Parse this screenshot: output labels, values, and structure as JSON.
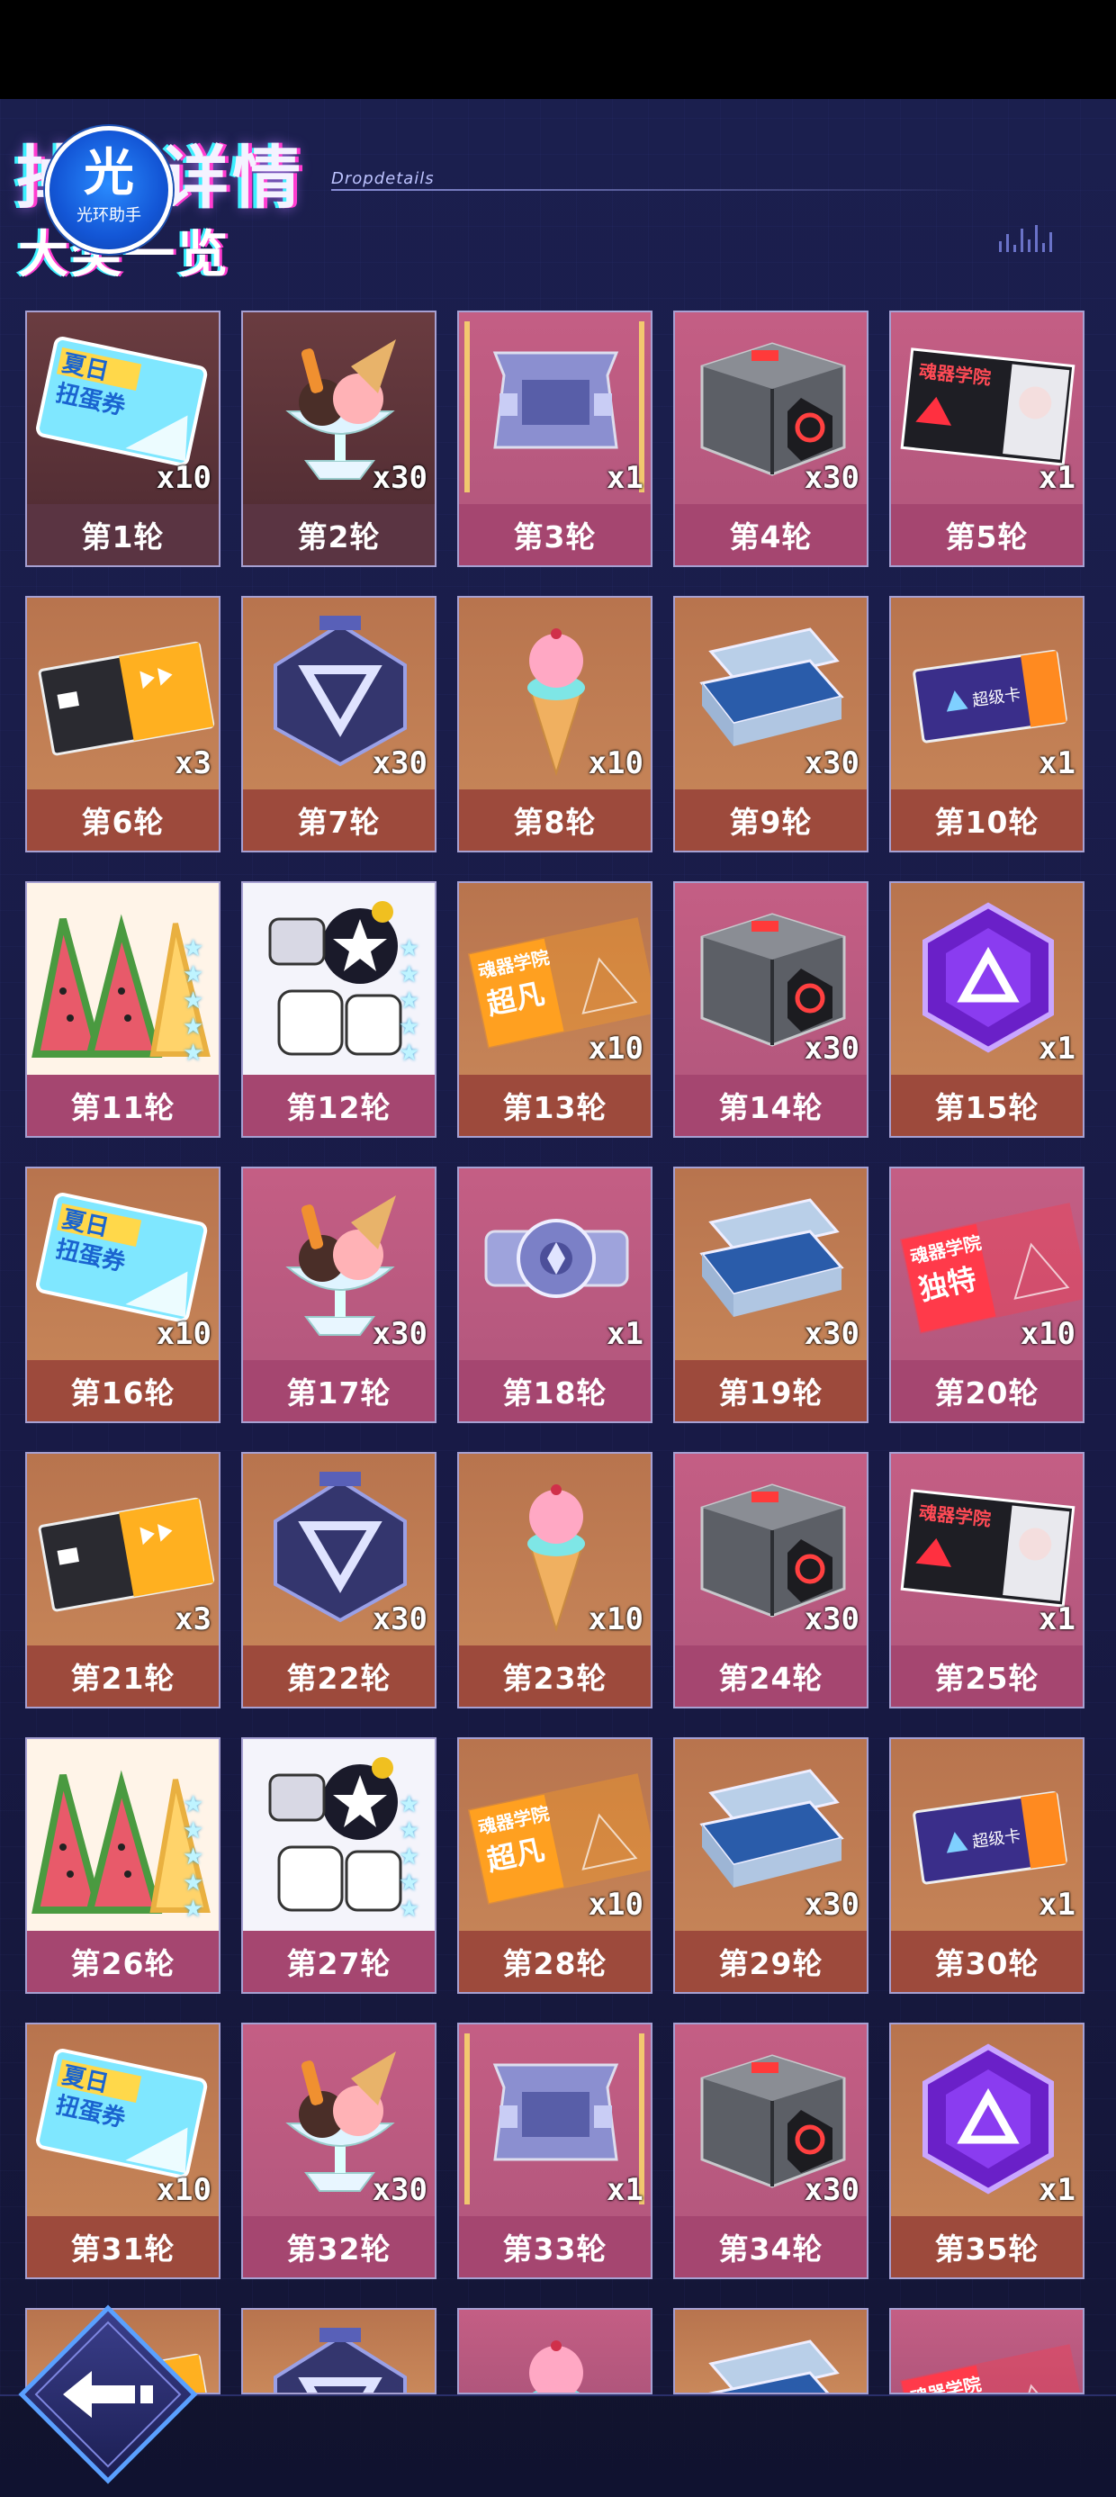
{
  "header": {
    "title": "掉落详情",
    "title_en": "Dropdetails",
    "subtitle": "大奖一览"
  },
  "watermark": {
    "glyph": "光",
    "name": "光环助手"
  },
  "colors": {
    "dark": "#5a3442",
    "pink": "#a54670",
    "orange": "#9d4a3c",
    "border": "#a6a0d2"
  },
  "rounds": [
    {
      "label": "第1轮",
      "qty": "x10",
      "item": "summer-ticket",
      "bg": "dark"
    },
    {
      "label": "第2轮",
      "qty": "x30",
      "item": "ice-cream-sundae",
      "bg": "dark"
    },
    {
      "label": "第3轮",
      "qty": "x1",
      "item": "frame-device",
      "bg": "pink"
    },
    {
      "label": "第4轮",
      "qty": "x30",
      "item": "tech-crate",
      "bg": "pink"
    },
    {
      "label": "第5轮",
      "qty": "x1",
      "item": "academy-card-girl",
      "bg": "pink"
    },
    {
      "label": "第6轮",
      "qty": "x3",
      "item": "black-gold-card",
      "bg": "orange"
    },
    {
      "label": "第7轮",
      "qty": "x30",
      "item": "triangle-core",
      "bg": "orange"
    },
    {
      "label": "第8轮",
      "qty": "x10",
      "item": "ice-cream-cone",
      "bg": "orange"
    },
    {
      "label": "第9轮",
      "qty": "x30",
      "item": "blue-chip-case",
      "bg": "orange"
    },
    {
      "label": "第10轮",
      "qty": "x1",
      "item": "purple-card",
      "bg": "orange"
    },
    {
      "label": "第11轮",
      "qty": "",
      "item": "watermelon",
      "bg": "pink"
    },
    {
      "label": "第12轮",
      "qty": "",
      "item": "mecha-pet",
      "bg": "pink"
    },
    {
      "label": "第13轮",
      "qty": "x10",
      "item": "academy-ticket-chaofan",
      "bg": "orange"
    },
    {
      "label": "第14轮",
      "qty": "x30",
      "item": "tech-crate",
      "bg": "pink"
    },
    {
      "label": "第15轮",
      "qty": "x1",
      "item": "purple-hex-badge",
      "bg": "orange"
    },
    {
      "label": "第16轮",
      "qty": "x10",
      "item": "summer-ticket",
      "bg": "orange"
    },
    {
      "label": "第17轮",
      "qty": "x30",
      "item": "ice-cream-sundae",
      "bg": "pink"
    },
    {
      "label": "第18轮",
      "qty": "x1",
      "item": "round-device",
      "bg": "pink"
    },
    {
      "label": "第19轮",
      "qty": "x30",
      "item": "blue-chip-case",
      "bg": "orange"
    },
    {
      "label": "第20轮",
      "qty": "x10",
      "item": "academy-ticket-dute",
      "bg": "pink"
    },
    {
      "label": "第21轮",
      "qty": "x3",
      "item": "black-gold-card",
      "bg": "orange"
    },
    {
      "label": "第22轮",
      "qty": "x30",
      "item": "triangle-core",
      "bg": "orange"
    },
    {
      "label": "第23轮",
      "qty": "x10",
      "item": "ice-cream-cone",
      "bg": "orange"
    },
    {
      "label": "第24轮",
      "qty": "x30",
      "item": "tech-crate",
      "bg": "pink"
    },
    {
      "label": "第25轮",
      "qty": "x1",
      "item": "academy-card-girl",
      "bg": "pink"
    },
    {
      "label": "第26轮",
      "qty": "",
      "item": "watermelon",
      "bg": "pink"
    },
    {
      "label": "第27轮",
      "qty": "",
      "item": "mecha-pet",
      "bg": "pink"
    },
    {
      "label": "第28轮",
      "qty": "x10",
      "item": "academy-ticket-chaofan",
      "bg": "orange"
    },
    {
      "label": "第29轮",
      "qty": "x30",
      "item": "blue-chip-case",
      "bg": "orange"
    },
    {
      "label": "第30轮",
      "qty": "x1",
      "item": "purple-card",
      "bg": "orange"
    },
    {
      "label": "第31轮",
      "qty": "x10",
      "item": "summer-ticket",
      "bg": "orange"
    },
    {
      "label": "第32轮",
      "qty": "x30",
      "item": "ice-cream-sundae",
      "bg": "pink"
    },
    {
      "label": "第33轮",
      "qty": "x1",
      "item": "frame-device",
      "bg": "pink"
    },
    {
      "label": "第34轮",
      "qty": "x30",
      "item": "tech-crate",
      "bg": "pink"
    },
    {
      "label": "第35轮",
      "qty": "x1",
      "item": "purple-hex-badge",
      "bg": "orange"
    },
    {
      "label": "",
      "qty": "",
      "item": "black-gold-card",
      "bg": "orange"
    },
    {
      "label": "",
      "qty": "",
      "item": "triangle-core",
      "bg": "orange"
    },
    {
      "label": "",
      "qty": "",
      "item": "ice-cream-cone",
      "bg": "pink"
    },
    {
      "label": "",
      "qty": "",
      "item": "blue-chip-case",
      "bg": "orange"
    },
    {
      "label": "",
      "qty": "",
      "item": "academy-ticket-dute",
      "bg": "pink"
    }
  ],
  "ticket_text": {
    "summer": "夏日\n扭蛋券",
    "academy": "魂器学院",
    "chaofan": "超凡",
    "dute": "独特",
    "purple": "超级卡"
  },
  "nav": {
    "back_icon": "back-arrow-icon"
  }
}
